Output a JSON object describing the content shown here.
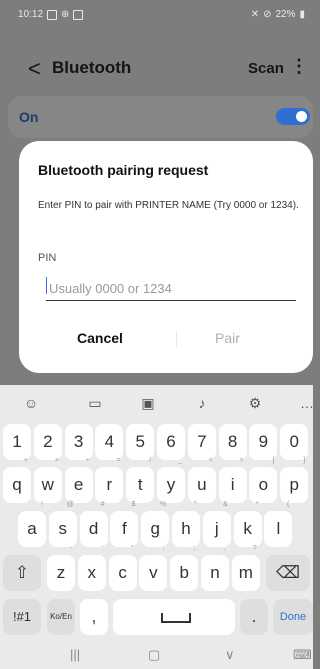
{
  "status": {
    "time": "10:12",
    "battery": "22%"
  },
  "appbar": {
    "back_icon": "chevron-left",
    "title": "Bluetooth",
    "scan": "Scan",
    "more_icon": "vertical-dots"
  },
  "onrow": {
    "label": "On",
    "toggle_on": true,
    "accent": "#2e6fd1"
  },
  "dialog": {
    "title": "Bluetooth pairing request",
    "message": "Enter PIN to pair with PRINTER NAME (Try 0000 or 1234).",
    "pin_label": "PIN",
    "pin_value": "",
    "pin_placeholder": "Usually 0000 or 1234",
    "cancel": "Cancel",
    "pair": "Pair"
  },
  "keyboard": {
    "toolbar_icons": [
      "emoji-icon",
      "clipboard-icon",
      "sticker-icon",
      "mic-icon",
      "settings-icon",
      "more-icon"
    ],
    "row1": [
      "1",
      "2",
      "3",
      "4",
      "5",
      "6",
      "7",
      "8",
      "9",
      "0"
    ],
    "row2": [
      "q",
      "w",
      "e",
      "r",
      "t",
      "y",
      "u",
      "i",
      "o",
      "p"
    ],
    "row2_hints": [
      "+",
      "×",
      "÷",
      "=",
      "/",
      "_",
      "<",
      ">",
      "[",
      "]"
    ],
    "row3": [
      "a",
      "s",
      "d",
      "f",
      "g",
      "h",
      "j",
      "k",
      "l"
    ],
    "row3_hints": [
      "!",
      "@",
      "#",
      "$",
      "%",
      "^",
      "&",
      "*",
      "("
    ],
    "row4": [
      "z",
      "x",
      "c",
      "v",
      "b",
      "n",
      "m"
    ],
    "row4_hints": [
      "-",
      "'",
      "\"",
      ":",
      ";",
      ",",
      "?"
    ],
    "symbols": "!#1",
    "lang": "Ko/En",
    "comma": ",",
    "period": ".",
    "done": "Done",
    "done_color": "#2e6fd1"
  },
  "nav": {
    "icons": [
      "recents-icon",
      "home-icon",
      "back-icon",
      "keyboard-icon"
    ]
  }
}
